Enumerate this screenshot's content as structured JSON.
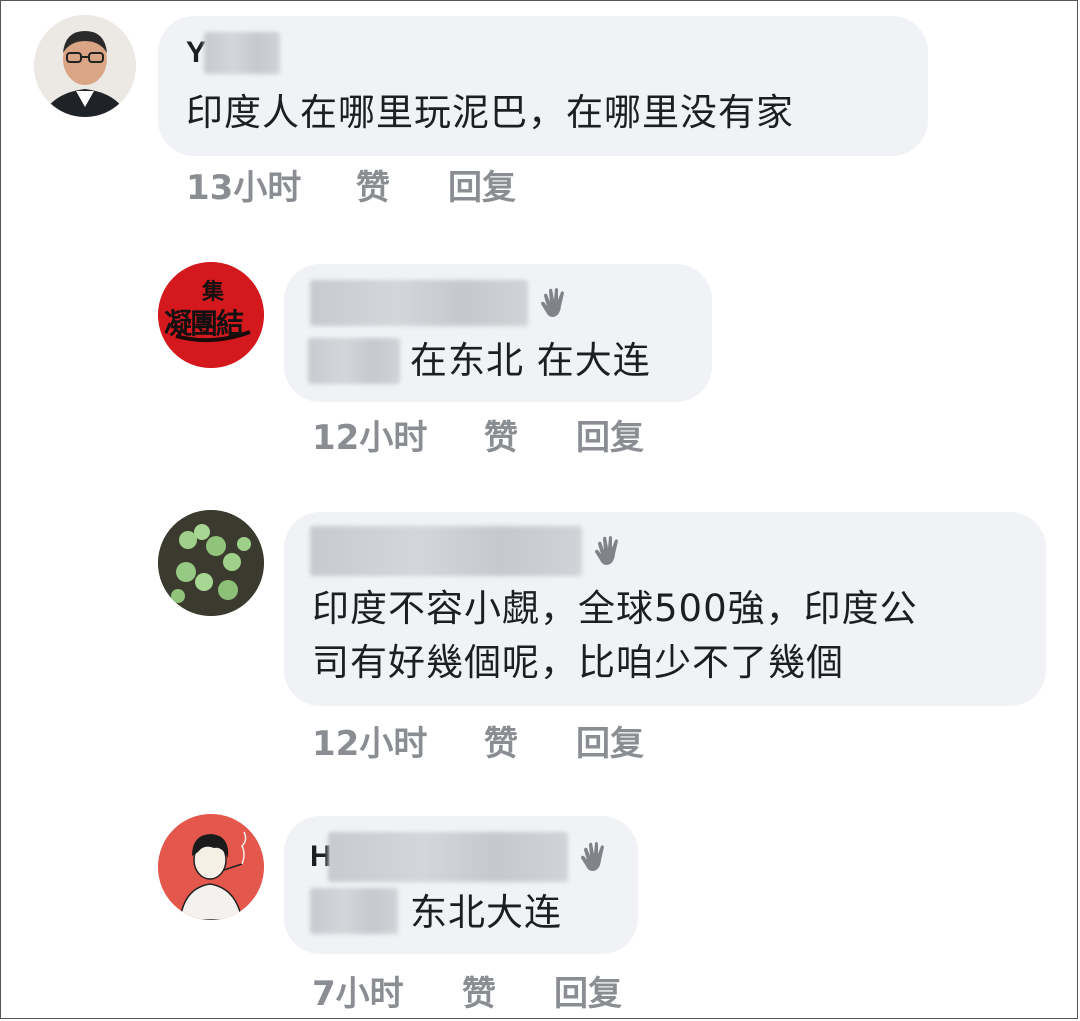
{
  "comments": [
    {
      "name_initial": "Y",
      "text_lines": [
        "印度人在哪里玩泥巴，在哪里没有家"
      ],
      "time": "13小时",
      "like_label": "赞",
      "reply_label": "回复"
    },
    {
      "name_initial": "",
      "text_lines": [
        "在东北 在大连"
      ],
      "time": "12小时",
      "like_label": "赞",
      "reply_label": "回复",
      "avatar_text_top": "集",
      "avatar_text_main": "凝團結"
    },
    {
      "name_initial": "",
      "text_lines": [
        "印度不容小覷，全球500強，印度公",
        "司有好幾個呢，比咱少不了幾個"
      ],
      "time": "12小时",
      "like_label": "赞",
      "reply_label": "回复"
    },
    {
      "name_initial": "H",
      "text_lines": [
        "东北大连"
      ],
      "time": "7小时",
      "like_label": "赞",
      "reply_label": "回复"
    }
  ],
  "colors": {
    "bubble": "#f0f2f5",
    "meta_text": "#8a8d91",
    "body_text": "#1c1e21",
    "avatar2_red": "#d4191e"
  },
  "icons": [
    "wave-hand-icon"
  ]
}
